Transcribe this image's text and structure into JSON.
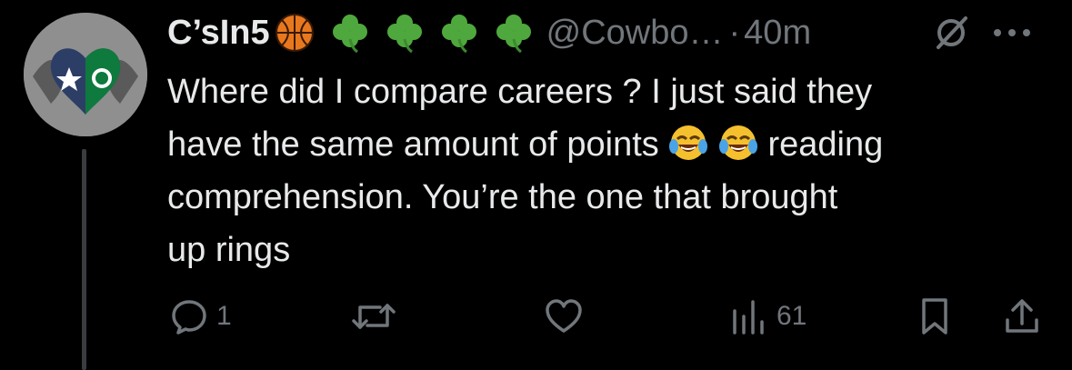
{
  "tweet": {
    "display_name": "C’sIn5",
    "name_emojis": [
      "basketball-emoji",
      "shamrock-emoji",
      "shamrock-emoji",
      "shamrock-emoji",
      "shamrock-emoji"
    ],
    "handle": "@Cowbo…",
    "separator": "·",
    "time": "40m",
    "text_lines": [
      "Where did I compare careers ? I just said they",
      "have the same amount of points",
      "reading",
      "comprehension. You’re the one that brought",
      "up rings"
    ],
    "inline_emojis": [
      "laughing-tears-emoji",
      "laughing-tears-emoji"
    ],
    "actions": {
      "reply_count": "1",
      "retweet_count": "",
      "like_count": "",
      "views_count": "61"
    }
  },
  "colors": {
    "background": "#000000",
    "text": "#e7e9ea",
    "muted": "#71767b",
    "thread_line": "#3a3d40"
  }
}
